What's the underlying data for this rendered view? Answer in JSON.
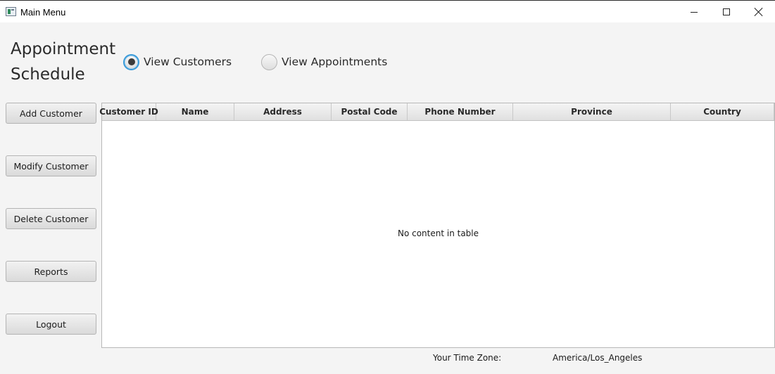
{
  "window": {
    "title": "Main Menu",
    "controls": [
      "minimize",
      "maximize",
      "close"
    ]
  },
  "heading": {
    "line1": "Appointment",
    "line2": "Schedule"
  },
  "view_toggle": {
    "options": [
      {
        "label": "View Customers",
        "selected": true
      },
      {
        "label": "View Appointments",
        "selected": false
      }
    ]
  },
  "sidebar": {
    "buttons": [
      {
        "label": "Add Customer"
      },
      {
        "label": "Modify Customer"
      },
      {
        "label": "Delete Customer"
      },
      {
        "label": "Reports"
      },
      {
        "label": "Logout"
      }
    ]
  },
  "table": {
    "columns": [
      "Customer ID",
      "Name",
      "Address",
      "Postal Code",
      "Phone Number",
      "Province",
      "Country"
    ],
    "rows": [],
    "empty_message": "No content in table"
  },
  "footer": {
    "time_zone_label": "Your Time Zone:",
    "time_zone_value": "America/Los_Angeles"
  },
  "colors": {
    "background": "#f4f4f4",
    "focus_accent": "#3a9bd9"
  }
}
